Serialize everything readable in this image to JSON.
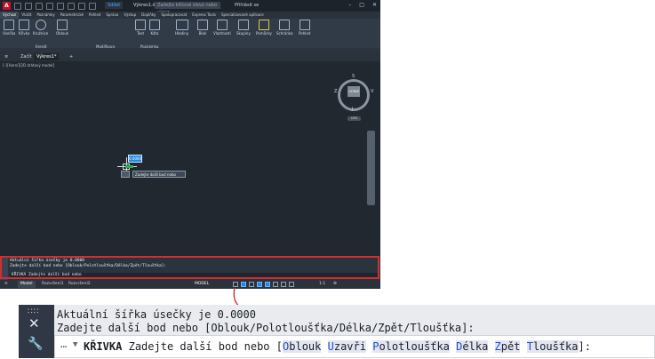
{
  "app": {
    "logo_letter": "A",
    "share_label": "Sdílet",
    "doc_title": "Výkres1.dwg",
    "search_placeholder": "Zadejte klíčové slovo nebo výraz",
    "user_label": "Přihlásit se",
    "win_min": "–",
    "win_max": "□",
    "win_close": "✕"
  },
  "ribbon_tabs": [
    "Výchozí",
    "Vložit",
    "Poznámky",
    "Parametrické",
    "Pohled",
    "Správa",
    "Výstup",
    "Doplňky",
    "Spolupracovat",
    "Express Tools",
    "Specializované aplikace"
  ],
  "ribbon_tools": {
    "line": "Úsečka",
    "polyline": "Křivka",
    "circle": "Kružnice",
    "arc": "Oblouk",
    "text": "Text",
    "dim": "Kóta",
    "layers": "Hladiny",
    "block": "Blok",
    "props": "Vlastnosti",
    "groups": "Skupiny",
    "utilities": "Pomůcky",
    "clipboard": "Schránka",
    "view": "Pohled"
  },
  "ribbon_panels": {
    "draw": "Kreslit",
    "modify": "Modifikace",
    "annotation": "Poznámka"
  },
  "file_tabs": {
    "start": "Začít",
    "drawing": "Výkres1*"
  },
  "viewport": {
    "label": "[–][Horní][2D drátový model]",
    "cube_label": "HORNÍ",
    "compass": {
      "n": "S",
      "s": "J",
      "e": "V",
      "w": "Z"
    },
    "wcs_label": "USS",
    "dyn_value": "0.0000",
    "tooltip": "Zadejte další bod nebo"
  },
  "command_line": {
    "history_1": "Aktuální šířka úsečky je 0.0000",
    "history_2": "Zadejte další bod nebo [Oblouk/Polotloušťka/Délka/Zpět/Tloušťka]:",
    "command_name": "KŘIVKA",
    "prompt": "Zadejte další bod nebo",
    "options": [
      {
        "label": "Oblouk",
        "hotkey": "O",
        "rest": "blouk"
      },
      {
        "label": "Uzavři",
        "hotkey": "U",
        "rest": "zavři"
      },
      {
        "label": "Polotloušťka",
        "hotkey": "P",
        "rest": "olotloušťka"
      },
      {
        "label": "Délka",
        "hotkey": "D",
        "rest": "élka"
      },
      {
        "label": "Zpět",
        "hotkey": "Z",
        "rest": "pět"
      },
      {
        "label": "Tloušťka",
        "hotkey": "T",
        "rest": "loušťka"
      }
    ],
    "open_bracket": "[",
    "close_bracket": "]:"
  },
  "status_bar": {
    "tab_model": "Model",
    "tab_layout1": "Rozvržení1",
    "tab_layout2": "Rozvržení2",
    "model_label": "MODEL",
    "scale": "1:1"
  },
  "colors": {
    "accent": "#1e88e5",
    "highlight_border": "#d32f2f",
    "hotkey": "#1f4fd1"
  }
}
